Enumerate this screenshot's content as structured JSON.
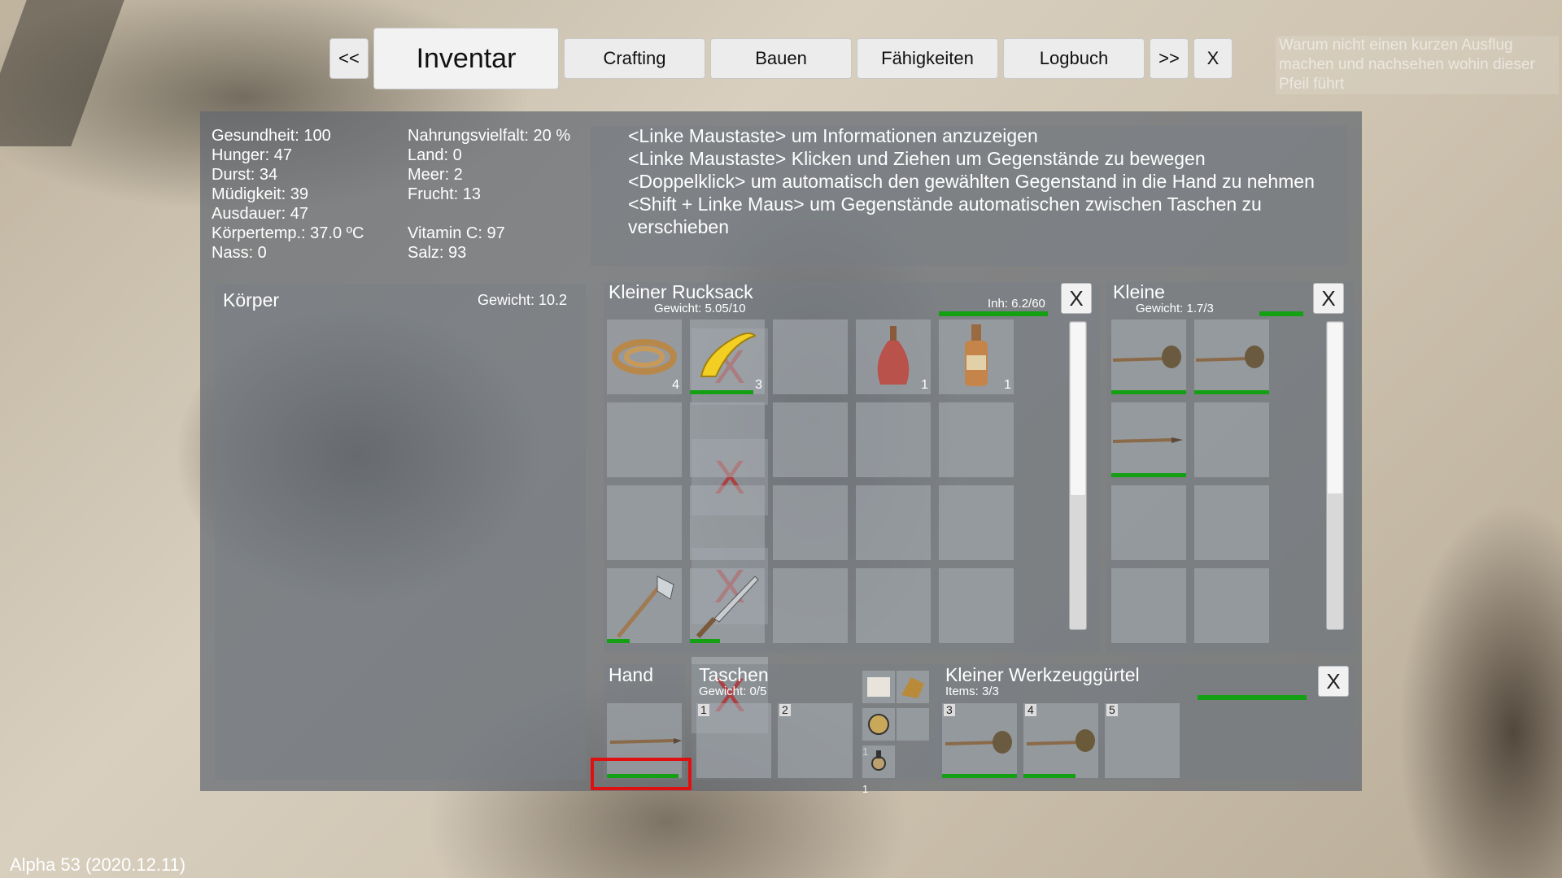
{
  "tabs": {
    "prev": "<<",
    "inventory": "Inventar",
    "crafting": "Crafting",
    "build": "Bauen",
    "skills": "Fähigkeiten",
    "log": "Logbuch",
    "next": ">>",
    "close": "X"
  },
  "hint": "Warum nicht einen kurzen Ausflug machen und nachsehen wohin dieser Pfeil führt",
  "stats_left": [
    "Gesundheit: 100",
    "Hunger: 47",
    "Durst: 34",
    "Müdigkeit: 39",
    "Ausdauer: 47",
    "Körpertemp.: 37.0 ºC",
    "Nass: 0"
  ],
  "stats_right": [
    "Nahrungsvielfalt: 20 %",
    "Land: 0",
    "Meer: 2",
    "Frucht: 13",
    "",
    "Vitamin C: 97",
    "Salz: 93"
  ],
  "help_lines": [
    "<Linke Maustaste> um Informationen anzuzeigen",
    "<Linke Maustaste> Klicken und Ziehen um Gegenstände zu bewegen",
    "<Doppelklick> um automatisch den gewählten Gegenstand in die Hand zu nehmen",
    "<Shift + Linke Maus> um Gegenstände automatischen zwischen Taschen zu verschieben"
  ],
  "body": {
    "title": "Körper",
    "weight": "Gewicht: 10.2",
    "slot_mark": "X"
  },
  "backpack": {
    "title": "Kleiner Rucksack",
    "weight": "Gewicht: 5.05/10",
    "content": "Inh: 6.2/60",
    "close": "X",
    "items": [
      {
        "slot": 0,
        "icon": "rope-icon",
        "count": "4"
      },
      {
        "slot": 1,
        "icon": "banana-icon",
        "count": "3",
        "durability": 0.85
      },
      {
        "slot": 3,
        "icon": "red-flask-icon",
        "count": "1"
      },
      {
        "slot": 4,
        "icon": "bottle-icon",
        "count": "1"
      },
      {
        "slot": 15,
        "icon": "axe-icon",
        "durability": 0.3
      },
      {
        "slot": 16,
        "icon": "knife-icon",
        "durability": 0.4
      }
    ]
  },
  "small_bag": {
    "title": "Kleine",
    "weight": "Gewicht: 1.7/3",
    "close": "X",
    "items": [
      {
        "slot": 0,
        "icon": "stone-hammer-icon",
        "durability": 1.0
      },
      {
        "slot": 1,
        "icon": "stone-hammer-icon",
        "durability": 1.0
      },
      {
        "slot": 2,
        "icon": "spear-icon",
        "durability": 1.0
      }
    ]
  },
  "hand": {
    "title": "Hand",
    "item": "spear-icon",
    "durability": 0.95
  },
  "pockets": {
    "title": "Taschen",
    "weight": "Gewicht: 0/5",
    "slots": [
      "1",
      "2"
    ],
    "mini_counts": [
      "1",
      "1"
    ]
  },
  "toolbelt": {
    "title": "Kleiner Werkzeuggürtel",
    "items_label": "Items: 3/3",
    "close": "X",
    "slots": [
      "3",
      "4",
      "5"
    ]
  },
  "version": "Alpha 53 (2020.12.11)"
}
